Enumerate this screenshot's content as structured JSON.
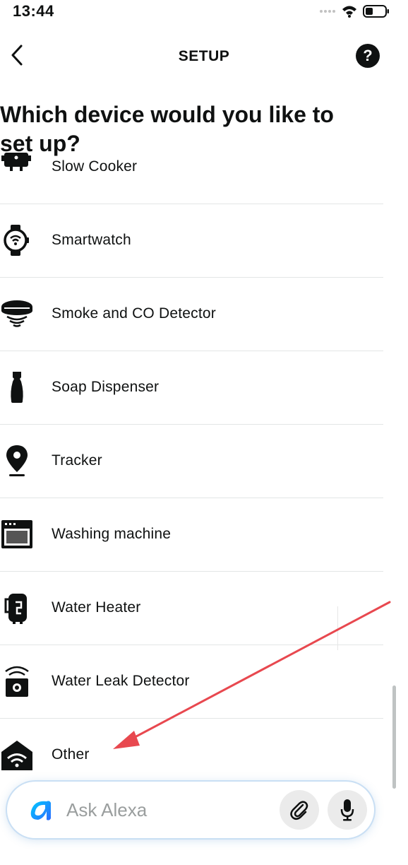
{
  "status_bar": {
    "time": "13:44",
    "icons": [
      "signal-icon",
      "wifi-icon",
      "battery-icon"
    ]
  },
  "header": {
    "title": "SETUP",
    "help_label": "?",
    "icons": [
      "back-chevron-icon",
      "help-icon"
    ]
  },
  "heading": "Which device would you like to set up?",
  "devices": [
    {
      "label": "Slow Cooker",
      "icon": "slow-cooker-icon"
    },
    {
      "label": "Smartwatch",
      "icon": "smartwatch-icon"
    },
    {
      "label": "Smoke and CO Detector",
      "icon": "smoke-detector-icon"
    },
    {
      "label": "Soap Dispenser",
      "icon": "soap-dispenser-icon"
    },
    {
      "label": "Tracker",
      "icon": "tracker-icon"
    },
    {
      "label": "Washing machine",
      "icon": "washing-machine-icon"
    },
    {
      "label": "Water Heater",
      "icon": "water-heater-icon"
    },
    {
      "label": "Water Leak Detector",
      "icon": "water-leak-detector-icon"
    },
    {
      "label": "Other",
      "icon": "other-device-icon"
    }
  ],
  "ask_bar": {
    "placeholder": "Ask Alexa",
    "icons": [
      "alexa-logo-icon",
      "attachment-icon",
      "microphone-icon"
    ]
  },
  "colors": {
    "text": "#0f1111",
    "divider": "#e3e6e6",
    "placeholder": "#9a9e9e",
    "annotation_arrow": "#e8484f",
    "alexa_blue": "#00caff"
  }
}
